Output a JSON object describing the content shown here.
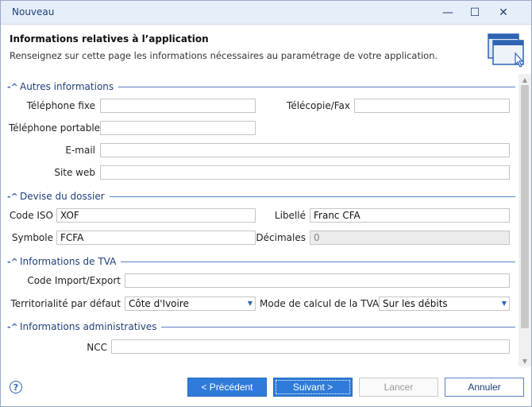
{
  "window": {
    "title": "Nouveau",
    "minimize": "—",
    "maximize": "☐",
    "close": "✕"
  },
  "header": {
    "title": "Informations relatives à l’application",
    "subtitle": "Renseignez sur cette page les informations nécessaires au paramétrage de votre application."
  },
  "sections": {
    "autres": {
      "toggle": "-^",
      "title": "Autres informations",
      "telephone_fixe_label": "Téléphone fixe",
      "telephone_fixe_value": "",
      "telecopie_label": "Télécopie/Fax",
      "telecopie_value": "",
      "telephone_portable_label": "Téléphone portable",
      "telephone_portable_value": "",
      "email_label": "E-mail",
      "email_value": "",
      "site_web_label": "Site web",
      "site_web_value": ""
    },
    "devise": {
      "toggle": "-^",
      "title": "Devise du dossier",
      "code_iso_label": "Code ISO",
      "code_iso_value": "XOF",
      "libelle_label": "Libellé",
      "libelle_value": "Franc CFA",
      "symbole_label": "Symbole",
      "symbole_value": "FCFA",
      "decimales_label": "Décimales",
      "decimales_value": "0"
    },
    "tva": {
      "toggle": "-^",
      "title": "Informations de TVA",
      "code_import_label": "Code Import/Export",
      "code_import_value": "",
      "territorialite_label": "Territorialité par défaut",
      "territorialite_value": "Côte d'Ivoire",
      "mode_calcul_label": "Mode de calcul de la TVA",
      "mode_calcul_value": "Sur les débits"
    },
    "admin": {
      "toggle": "-^",
      "title": "Informations administratives",
      "ncc_label": "NCC",
      "ncc_value": ""
    }
  },
  "footer": {
    "help": "?",
    "previous": "< Précédent",
    "next": "Suivant >",
    "cancel": "Lancer",
    "abort": "Annuler"
  }
}
